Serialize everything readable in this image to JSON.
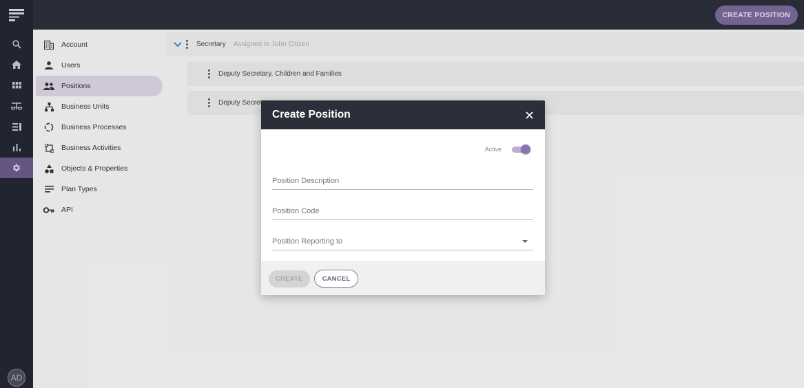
{
  "header": {
    "create_position_label": "CREATE POSITION"
  },
  "rail": {
    "items": [
      {
        "icon": "search-icon"
      },
      {
        "icon": "home-icon"
      },
      {
        "icon": "grid-icon"
      },
      {
        "icon": "scales-icon"
      },
      {
        "icon": "list-icon"
      },
      {
        "icon": "bar-chart-icon"
      },
      {
        "icon": "gear-icon",
        "active": true
      }
    ],
    "avatar_initials": "AD"
  },
  "settings_nav": {
    "items": [
      {
        "label": "Account",
        "icon": "building-icon"
      },
      {
        "label": "Users",
        "icon": "user-icon"
      },
      {
        "label": "Positions",
        "icon": "people-icon",
        "active": true
      },
      {
        "label": "Business Units",
        "icon": "hierarchy-icon"
      },
      {
        "label": "Business Processes",
        "icon": "cycle-icon"
      },
      {
        "label": "Business Activities",
        "icon": "activity-icon"
      },
      {
        "label": "Objects & Properties",
        "icon": "shapes-icon"
      },
      {
        "label": "Plan Types",
        "icon": "lines-icon"
      },
      {
        "label": "API",
        "icon": "key-icon"
      }
    ]
  },
  "positions": {
    "root": {
      "name": "Secretary",
      "assigned": "Assigned to John Citizen"
    },
    "children": [
      {
        "name": "Deputy Secretary, Children and Families"
      },
      {
        "name": "Deputy Secreta"
      }
    ]
  },
  "dialog": {
    "title": "Create Position",
    "active_label": "Active",
    "active": true,
    "fields": {
      "description_placeholder": "Position Description",
      "code_placeholder": "Position Code",
      "reporting_placeholder": "Position Reporting to"
    },
    "create_label": "CREATE",
    "cancel_label": "CANCEL"
  },
  "colors": {
    "topbar": "#2b2f3a",
    "accent": "#7b6a99",
    "nav_active": "#ddd5e5"
  }
}
